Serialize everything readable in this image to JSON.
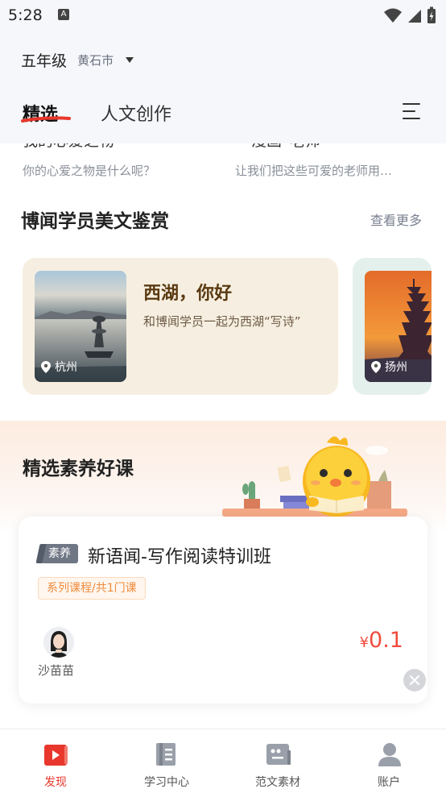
{
  "status_bar": {
    "time": "5:28",
    "notification_icon": "A"
  },
  "header": {
    "grade": "五年级",
    "city": "黄石市",
    "tabs": [
      {
        "label": "精选",
        "active": true
      },
      {
        "label": "人文创作",
        "active": false
      }
    ]
  },
  "articles": [
    {
      "title": "我的心爱之物",
      "subtitle": "你的心爱之物是什么呢？"
    },
    {
      "title": "漫画“老师”",
      "subtitle": "让我们把这些可爱的老师用…"
    }
  ],
  "appreciation": {
    "title": "博闻学员美文鉴赏",
    "more": "查看更多",
    "cards": [
      {
        "title": "西湖，你好",
        "description": "和博闻学员一起为西湖“写诗”",
        "location": "杭州"
      },
      {
        "location": "扬州"
      }
    ]
  },
  "courses": {
    "title": "精选素养好课",
    "item": {
      "badge": "素养",
      "title": "新语闻-写作阅读特训班",
      "tag": "系列课程/共1门课",
      "teacher": "沙苗苗",
      "currency": "¥",
      "price": "0.1"
    }
  },
  "bottom_nav": [
    {
      "label": "发现",
      "icon": "play-icon",
      "active": true
    },
    {
      "label": "学习中心",
      "icon": "book-icon",
      "active": false
    },
    {
      "label": "范文素材",
      "icon": "quote-icon",
      "active": false
    },
    {
      "label": "账户",
      "icon": "user-icon",
      "active": false
    }
  ],
  "colors": {
    "accent": "#e8372c",
    "price": "#f04c3e",
    "card_bg": "#f6efe1",
    "tag_text": "#f08a3c"
  }
}
